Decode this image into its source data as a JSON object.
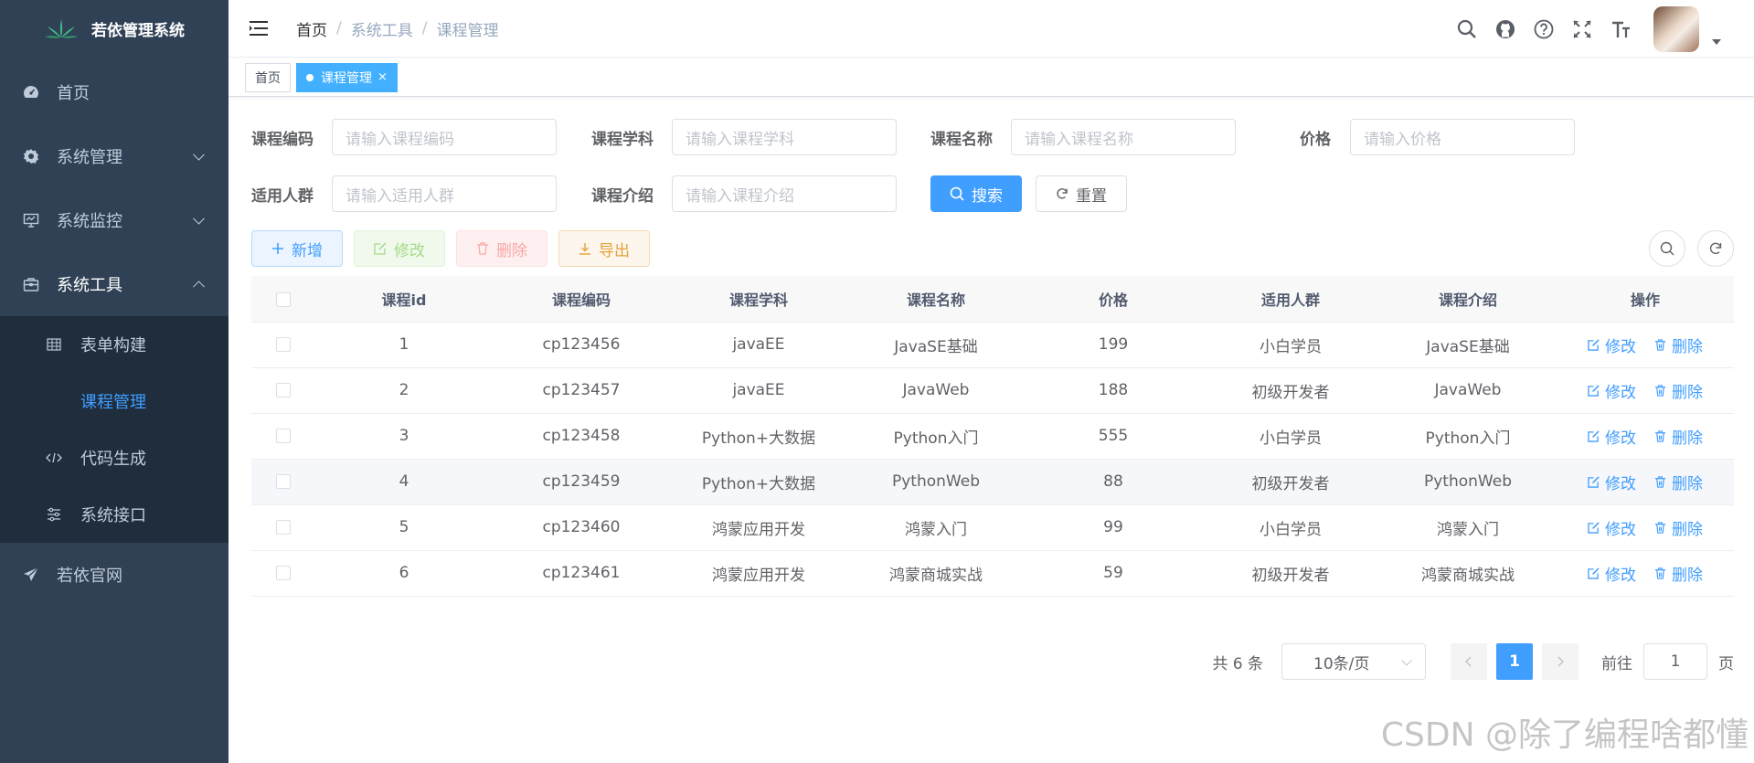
{
  "sidebar": {
    "logo_text": "若依管理系统",
    "items": [
      {
        "label": "首页"
      },
      {
        "label": "系统管理"
      },
      {
        "label": "系统监控"
      },
      {
        "label": "系统工具"
      },
      {
        "label": "若依官网"
      }
    ],
    "sub_items": [
      {
        "label": "表单构建"
      },
      {
        "label": "课程管理"
      },
      {
        "label": "代码生成"
      },
      {
        "label": "系统接口"
      }
    ]
  },
  "header": {
    "breadcrumb": [
      "首页",
      "系统工具",
      "课程管理"
    ],
    "separator": "/"
  },
  "tags": [
    {
      "label": "首页"
    },
    {
      "label": "课程管理",
      "close": "×"
    }
  ],
  "search": {
    "code_label": "课程编码",
    "code_placeholder": "请输入课程编码",
    "subject_label": "课程学科",
    "subject_placeholder": "请输入课程学科",
    "name_label": "课程名称",
    "name_placeholder": "请输入课程名称",
    "price_label": "价格",
    "price_placeholder": "请输入价格",
    "crowd_label": "适用人群",
    "crowd_placeholder": "请输入适用人群",
    "intro_label": "课程介绍",
    "intro_placeholder": "请输入课程介绍",
    "search_button": "搜索",
    "reset_button": "重置"
  },
  "toolbar": {
    "add": "新增",
    "edit": "修改",
    "delete": "删除",
    "export": "导出"
  },
  "table": {
    "headers": [
      "课程id",
      "课程编码",
      "课程学科",
      "课程名称",
      "价格",
      "适用人群",
      "课程介绍",
      "操作"
    ],
    "edit_label": "修改",
    "delete_label": "删除",
    "rows": [
      [
        "1",
        "cp123456",
        "javaEE",
        "JavaSE基础",
        "199",
        "小白学员",
        "JavaSE基础"
      ],
      [
        "2",
        "cp123457",
        "javaEE",
        "JavaWeb",
        "188",
        "初级开发者",
        "JavaWeb"
      ],
      [
        "3",
        "cp123458",
        "Python+大数据",
        "Python入门",
        "555",
        "小白学员",
        "Python入门"
      ],
      [
        "4",
        "cp123459",
        "Python+大数据",
        "PythonWeb",
        "88",
        "初级开发者",
        "PythonWeb"
      ],
      [
        "5",
        "cp123460",
        "鸿蒙应用开发",
        "鸿蒙入门",
        "99",
        "小白学员",
        "鸿蒙入门"
      ],
      [
        "6",
        "cp123461",
        "鸿蒙应用开发",
        "鸿蒙商城实战",
        "59",
        "初级开发者",
        "鸿蒙商城实战"
      ]
    ]
  },
  "pagination": {
    "total": "共 6 条",
    "page_size": "10条/页",
    "current_page": "1",
    "goto_label": "前往",
    "goto_value": "1",
    "page_unit": "页"
  },
  "watermark": "CSDN @除了编程啥都懂",
  "colors": {
    "sidebar_bg": "#304156",
    "submenu_bg": "#1f2d3d",
    "primary": "#409eff"
  }
}
